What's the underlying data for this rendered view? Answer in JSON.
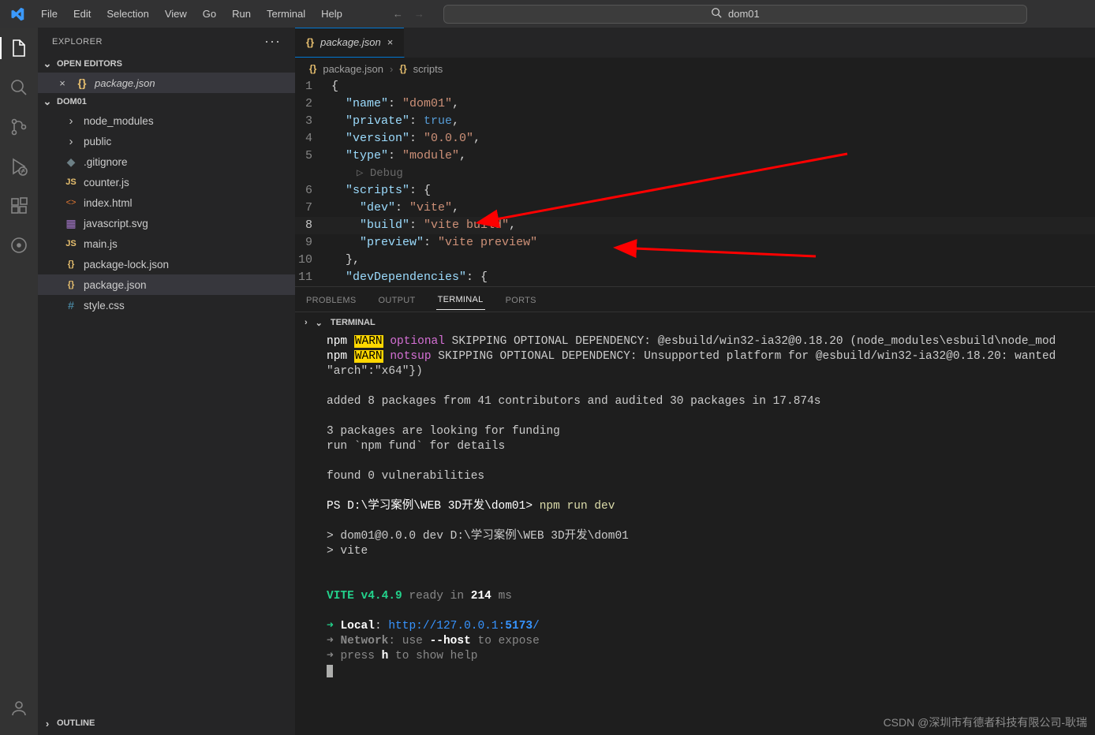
{
  "menu": [
    "File",
    "Edit",
    "Selection",
    "View",
    "Go",
    "Run",
    "Terminal",
    "Help"
  ],
  "search_text": "dom01",
  "explorer": {
    "title": "EXPLORER",
    "open_editors": "OPEN EDITORS",
    "open_file": "package.json",
    "workspace": "DOM01",
    "outline": "OUTLINE",
    "files": [
      {
        "name": "node_modules",
        "icon": "›",
        "type": "folder"
      },
      {
        "name": "public",
        "icon": "›",
        "type": "folder"
      },
      {
        "name": ".gitignore",
        "icon": "◆",
        "cls": "col-gray",
        "type": "file"
      },
      {
        "name": "counter.js",
        "icon": "JS",
        "cls": "col-yellow",
        "type": "file"
      },
      {
        "name": "index.html",
        "icon": "<>",
        "cls": "col-orange",
        "type": "file"
      },
      {
        "name": "javascript.svg",
        "icon": "▦",
        "cls": "col-purple",
        "type": "file"
      },
      {
        "name": "main.js",
        "icon": "JS",
        "cls": "col-yellow",
        "type": "file"
      },
      {
        "name": "package-lock.json",
        "icon": "{}",
        "cls": "col-brace",
        "type": "file"
      },
      {
        "name": "package.json",
        "icon": "{}",
        "cls": "col-brace",
        "type": "file",
        "selected": true
      },
      {
        "name": "style.css",
        "icon": "#",
        "cls": "col-hash",
        "type": "file"
      }
    ]
  },
  "tab": {
    "icon": "{}",
    "label": "package.json"
  },
  "breadcrumb": [
    {
      "icon": "{}",
      "label": "package.json"
    },
    {
      "icon": "{}",
      "label": "scripts"
    }
  ],
  "code_lines": [
    {
      "n": 1,
      "html": "<span class='s-punct'>{</span>"
    },
    {
      "n": 2,
      "html": "  <span class='s-key'>\"name\"</span><span class='s-punct'>: </span><span class='s-str'>\"dom01\"</span><span class='s-punct'>,</span>"
    },
    {
      "n": 3,
      "html": "  <span class='s-key'>\"private\"</span><span class='s-punct'>: </span><span class='s-bool'>true</span><span class='s-punct'>,</span>"
    },
    {
      "n": 4,
      "html": "  <span class='s-key'>\"version\"</span><span class='s-punct'>: </span><span class='s-str'>\"0.0.0\"</span><span class='s-punct'>,</span>"
    },
    {
      "n": 5,
      "html": "  <span class='s-key'>\"type\"</span><span class='s-punct'>: </span><span class='s-str'>\"module\"</span><span class='s-punct'>,</span>"
    },
    {
      "n": "debug",
      "html": "▷ Debug",
      "debug": true
    },
    {
      "n": 6,
      "html": "  <span class='s-key'>\"scripts\"</span><span class='s-punct'>: {</span>"
    },
    {
      "n": 7,
      "html": "    <span class='s-key'>\"dev\"</span><span class='s-punct'>: </span><span class='s-str'>\"vite\"</span><span class='s-punct'>,</span>"
    },
    {
      "n": 8,
      "html": "    <span class='s-key'>\"build\"</span><span class='s-punct'>: </span><span class='s-str'>\"vite build\"</span><span class='s-punct'>,</span>",
      "current": true
    },
    {
      "n": 9,
      "html": "    <span class='s-key'>\"preview\"</span><span class='s-punct'>: </span><span class='s-str'>\"vite preview\"</span>"
    },
    {
      "n": 10,
      "html": "  <span class='s-punct'>},</span>"
    },
    {
      "n": 11,
      "html": "  <span class='s-key'>\"devDependencies\"</span><span class='s-punct'>: {</span>"
    }
  ],
  "panel": {
    "tabs": [
      "PROBLEMS",
      "OUTPUT",
      "TERMINAL",
      "PORTS"
    ],
    "active": "TERMINAL",
    "sub": "TERMINAL"
  },
  "terminal": [
    "<span class='tw'>npm</span> <span class='hl-warn'>WARN</span> <span class='tmag'>optional</span> SKIPPING OPTIONAL DEPENDENCY: @esbuild/win32-ia32@0.18.20 (node_modules\\esbuild\\node_mod",
    "<span class='tw'>npm</span> <span class='hl-warn'>WARN</span> <span class='tmag'>notsup</span> SKIPPING OPTIONAL DEPENDENCY: Unsupported platform for @esbuild/win32-ia32@0.18.20: wanted",
    "\"arch\":\"x64\"})",
    "",
    "added 8 packages from 41 contributors and audited 30 packages in 17.874s",
    "",
    "3 packages are looking for funding",
    "  run `npm fund` for details",
    "",
    "found 0 vulnerabilities",
    "",
    "<span class='tw'>PS D:\\学习案例\\WEB 3D开发\\dom01&gt;</span> <span class='ty'>npm run dev</span>",
    "",
    "&gt; dom01@0.0.0 dev D:\\学习案例\\WEB 3D开发\\dom01",
    "&gt; vite",
    "",
    "",
    "  <span class='tg tb'>VITE v4.4.9</span>  <span class='tgrey'>ready in</span> <span class='tw tb'>214</span> <span class='tgrey'>ms</span>",
    "",
    "  <span class='arrow-right-green'></span><span class='tw tb'>Local</span>:   <span class='tlink'>http://127.0.0.1:</span><span class='tlink tb'>5173</span><span class='tlink'>/</span>",
    "  <span class='arrow-right-dim'></span><span class='tgrey tb'>Network</span><span class='tgrey'>: use </span><span class='tw tb'>--host</span><span class='tgrey'> to expose</span>",
    "  <span class='arrow-right-dim'></span><span class='tgrey'>press </span><span class='tw tb'>h</span><span class='tgrey'> to show help</span>"
  ],
  "watermark": "CSDN @深圳市有德者科技有限公司-耿瑞"
}
